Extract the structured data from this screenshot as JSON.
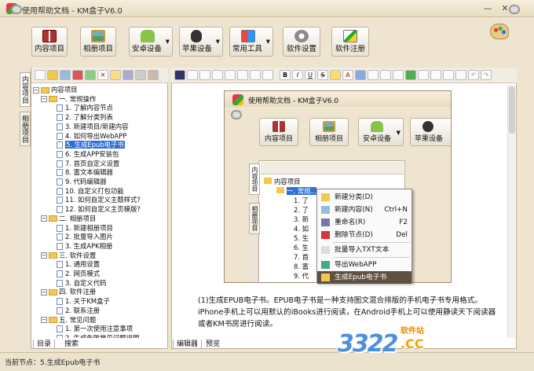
{
  "window": {
    "title": "使用帮助文档 - KM盒子V6.0",
    "minimize": "—",
    "close": "✕"
  },
  "toolbar": {
    "buttons": [
      {
        "label": "内容项目",
        "has_arrow": false
      },
      {
        "label": "相册项目",
        "has_arrow": false
      },
      {
        "label": "安卓设备",
        "has_arrow": true
      },
      {
        "label": "苹果设备",
        "has_arrow": true
      },
      {
        "label": "常用工具",
        "has_arrow": true
      },
      {
        "label": "软件设置",
        "has_arrow": false
      },
      {
        "label": "软件注册",
        "has_arrow": false
      }
    ]
  },
  "side_tabs": [
    "内容项目",
    "相册项目"
  ],
  "tree": {
    "root": "内容项目",
    "items": [
      {
        "text": "一. 常规操作",
        "type": "folder",
        "level": 1
      },
      {
        "text": "1. 了解内容节点",
        "type": "doc",
        "level": 2
      },
      {
        "text": "2. 了解分类列表",
        "type": "doc",
        "level": 2
      },
      {
        "text": "3. 新建项目/新建内容",
        "type": "doc",
        "level": 2
      },
      {
        "text": "4. 如何导出WebAPP",
        "type": "doc",
        "level": 2
      },
      {
        "text": "5. 生成Epub电子书",
        "type": "doc",
        "level": 2,
        "selected": true
      },
      {
        "text": "6. 生成APP安装包",
        "type": "doc",
        "level": 2
      },
      {
        "text": "7. 首页自定义设置",
        "type": "doc",
        "level": 2
      },
      {
        "text": "8. 富文本编辑器",
        "type": "doc",
        "level": 2
      },
      {
        "text": "9. 代码编辑器",
        "type": "doc",
        "level": 2
      },
      {
        "text": "10. 自定义打包功能",
        "type": "doc",
        "level": 2
      },
      {
        "text": "11. 如何自定义主题样式?",
        "type": "doc",
        "level": 2
      },
      {
        "text": "12. 如何自定义主页模版?",
        "type": "doc",
        "level": 2
      },
      {
        "text": "二. 相册项目",
        "type": "folder",
        "level": 1
      },
      {
        "text": "1. 新建相册项目",
        "type": "doc",
        "level": 2
      },
      {
        "text": "2. 批量导入图片",
        "type": "doc",
        "level": 2
      },
      {
        "text": "3. 生成APK相册",
        "type": "doc",
        "level": 2
      },
      {
        "text": "三. 软件设置",
        "type": "folder",
        "level": 1
      },
      {
        "text": "1. 通用设置",
        "type": "doc",
        "level": 2
      },
      {
        "text": "2. 网页模式",
        "type": "doc",
        "level": 2
      },
      {
        "text": "3. 自定义代码",
        "type": "doc",
        "level": 2
      },
      {
        "text": "四. 软件注册",
        "type": "folder",
        "level": 1
      },
      {
        "text": "1. 关于KM盒子",
        "type": "doc",
        "level": 2
      },
      {
        "text": "2. 联系注册",
        "type": "doc",
        "level": 2
      },
      {
        "text": "五. 常见问题",
        "type": "folder",
        "level": 1
      },
      {
        "text": "1. 第一次使用注意事项",
        "type": "doc",
        "level": 2
      },
      {
        "text": "2. 生成失败常见问题说明",
        "type": "doc",
        "level": 2
      }
    ]
  },
  "left_bottom_tabs": [
    "目录",
    "搜索"
  ],
  "right_bottom_tabs": [
    "编辑器",
    "预览"
  ],
  "editor_toolbar": [
    "B",
    "I",
    "U",
    "S",
    "A",
    "≡",
    "≡",
    "≡",
    "≡"
  ],
  "inner_screenshot": {
    "title": "使用帮助文档 - KM盒子V6.0",
    "buttons": [
      "内容项目",
      "相册项目",
      "安卓设备",
      "苹果设备"
    ],
    "side_tabs": [
      "内容项目",
      "相册项目"
    ],
    "tree_root": "内容项目",
    "tree_first": "一. 常规...",
    "context_menu": [
      {
        "label": "新建分类(D)",
        "shortcut": ""
      },
      {
        "label": "新建内容(N)",
        "shortcut": "Ctrl+N"
      },
      {
        "label": "重命名(R)",
        "shortcut": "F2"
      },
      {
        "label": "删除节点(D)",
        "shortcut": "Del"
      },
      {
        "label": "批量导入TXT文本",
        "shortcut": ""
      },
      {
        "label": "导出WebAPP",
        "shortcut": ""
      },
      {
        "label": "生成Epub电子书",
        "shortcut": "",
        "highlighted": true
      }
    ]
  },
  "content": {
    "paragraph": "(1)生成EPUB电子书。EPUB电子书是一种支持图文混合排版的手机电子书专用格式。iPhone手机上可以用默认的iBooks进行阅读，在Android手机上可以使用静读天下阅读器或者KM书房进行阅读。"
  },
  "status": {
    "text": "当前节点：5.生成Epub电子书"
  },
  "watermark": {
    "number": "3322",
    "site": "软件站",
    "domain": ".CC"
  },
  "colors": {
    "accent": "#2f6fd6",
    "frame": "#efe4cf",
    "menu_highlight": "#5f5142"
  }
}
